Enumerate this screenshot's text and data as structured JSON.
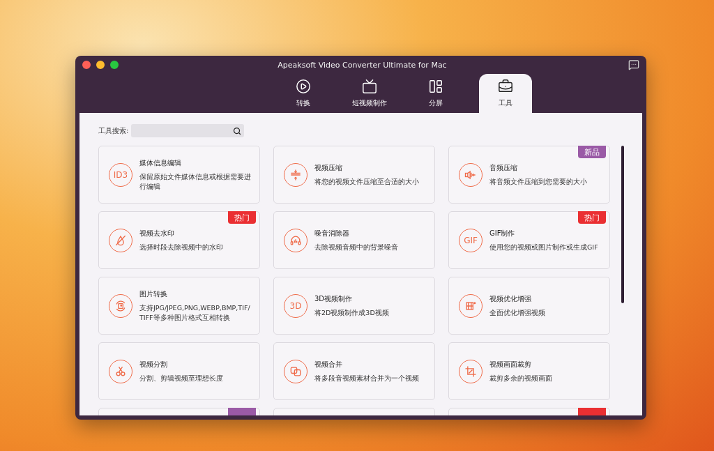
{
  "window": {
    "title": "Apeaksoft Video Converter Ultimate for Mac"
  },
  "tabs": [
    {
      "label": "转换",
      "selected": false
    },
    {
      "label": "短视频制作",
      "selected": false
    },
    {
      "label": "分屏",
      "selected": false
    },
    {
      "label": "工具",
      "selected": true
    }
  ],
  "search": {
    "label": "工具搜索:"
  },
  "tools": [
    {
      "kind": "tool",
      "title": "媒体信息编辑",
      "description": "保留原始文件媒体信息或根据需要进行编辑",
      "icon_text": "ID3"
    },
    {
      "kind": "tool",
      "title": "视频压缩",
      "description": "将您的视频文件压缩至合适的大小"
    },
    {
      "kind": "tool",
      "title": "音频压缩",
      "description": "将音频文件压缩到您需要的大小",
      "badge": {
        "kind": "new",
        "text": "新品"
      }
    },
    {
      "kind": "tool",
      "title": "视频去水印",
      "description": "选择时段去除视频中的水印",
      "badge": {
        "kind": "hot",
        "text": "热门"
      }
    },
    {
      "kind": "tool",
      "title": "噪音消除器",
      "description": "去除视频音频中的背景噪音"
    },
    {
      "kind": "tool",
      "title": "GIF制作",
      "description": "使用您的视频或图片制作或生成GIF",
      "badge": {
        "kind": "hot",
        "text": "热门"
      },
      "icon_text": "GIF"
    },
    {
      "kind": "tool",
      "title": "图片转换",
      "description": "支持JPG/JPEG,PNG,WEBP,BMP,TIF/ TIFF等多种图片格式互相转换"
    },
    {
      "kind": "tool",
      "title": "3D视频制作",
      "description": "将2D视频制作成3D视频",
      "icon_text": "3D"
    },
    {
      "kind": "tool",
      "title": "视频优化增强",
      "description": "全面优化增强视频"
    },
    {
      "kind": "tool",
      "title": "视频分割",
      "description": "分割、剪辑视频至理想长度"
    },
    {
      "kind": "tool",
      "title": "视频合并",
      "description": "将多段音视频素材合并为一个视频"
    },
    {
      "kind": "tool",
      "title": "视频画面裁剪",
      "description": "裁剪多余的视频画面"
    },
    {
      "kind": "partial",
      "badge": {
        "kind": "new"
      }
    },
    {
      "kind": "partial"
    },
    {
      "kind": "partial",
      "badge": {
        "kind": "hot"
      }
    }
  ]
}
